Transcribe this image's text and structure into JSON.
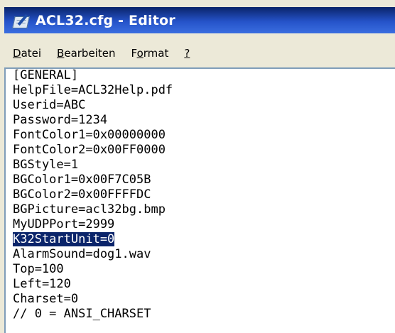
{
  "window": {
    "title": "ACL32.cfg - Editor",
    "icon": "notepad-icon"
  },
  "menu": [
    {
      "accel": "D",
      "rest": "atei"
    },
    {
      "accel": "B",
      "rest": "earbeiten"
    },
    {
      "pre": "F",
      "accel": "o",
      "rest": "rmat"
    },
    {
      "accel": "?",
      "rest": ""
    }
  ],
  "editor": {
    "lines": [
      "[GENERAL]",
      "HelpFile=ACL32Help.pdf",
      "Userid=ABC",
      "Password=1234",
      "FontColor1=0x00000000",
      "FontColor2=0x00FF0000",
      "BGStyle=1",
      "BGColor1=0x00F7C05B",
      "BGColor2=0x00FFFFDC",
      "BGPicture=acl32bg.bmp",
      "MyUDPPort=2999",
      "K32StartUnit=0",
      "AlarmSound=dog1.wav",
      "Top=100",
      "Left=120",
      "Charset=0",
      "// 0 = ANSI_CHARSET"
    ],
    "selected_line": 11,
    "selection_color": "#0a246a"
  },
  "colors": {
    "titlebar": "#0a246a",
    "window_bg": "#ece9d8",
    "editor_border": "#7f9db9"
  }
}
